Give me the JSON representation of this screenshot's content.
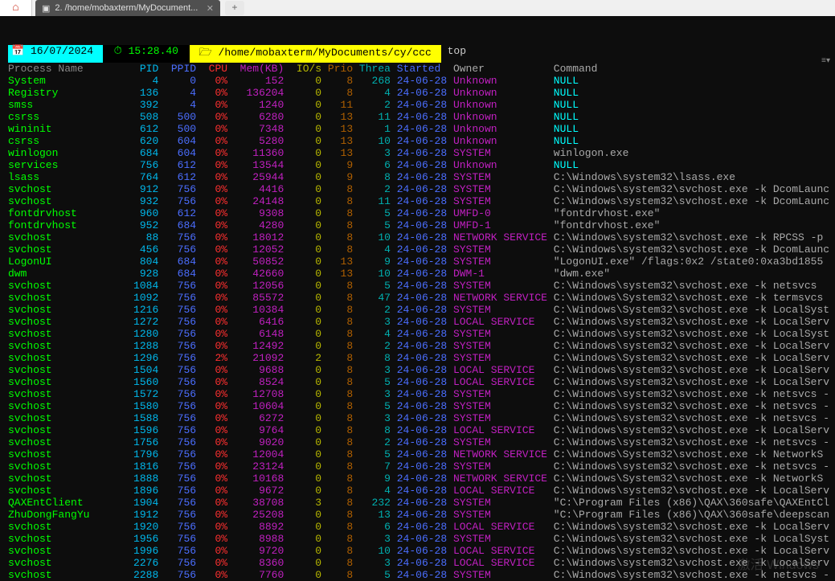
{
  "tab": {
    "title": "2. /home/mobaxterm/MyDocument..."
  },
  "status": {
    "date": "16/07/2024",
    "time": "15:28.40",
    "path": "/home/mobaxterm/MyDocuments/cy/ccc",
    "cmd": "top"
  },
  "headers": {
    "proc": "Process Name",
    "pid": "PID",
    "ppid": "PPID",
    "cpu": "CPU",
    "mem": "Mem(KB)",
    "io": "IO/s",
    "prio": "Prio",
    "threa": "Threa",
    "started": "Started",
    "owner": "Owner",
    "command": "Command"
  },
  "rows": [
    {
      "name": "System",
      "pid": "4",
      "ppid": "0",
      "cpu": "0%",
      "mem": "152",
      "io": "0",
      "prio": "8",
      "threa": "268",
      "started": "24-06-28",
      "owner": "Unknown",
      "cmd": "NULL"
    },
    {
      "name": "Registry",
      "pid": "136",
      "ppid": "4",
      "cpu": "0%",
      "mem": "136204",
      "io": "0",
      "prio": "8",
      "threa": "4",
      "started": "24-06-28",
      "owner": "Unknown",
      "cmd": "NULL"
    },
    {
      "name": "smss",
      "pid": "392",
      "ppid": "4",
      "cpu": "0%",
      "mem": "1240",
      "io": "0",
      "prio": "11",
      "threa": "2",
      "started": "24-06-28",
      "owner": "Unknown",
      "cmd": "NULL"
    },
    {
      "name": "csrss",
      "pid": "508",
      "ppid": "500",
      "cpu": "0%",
      "mem": "6280",
      "io": "0",
      "prio": "13",
      "threa": "11",
      "started": "24-06-28",
      "owner": "Unknown",
      "cmd": "NULL"
    },
    {
      "name": "wininit",
      "pid": "612",
      "ppid": "500",
      "cpu": "0%",
      "mem": "7348",
      "io": "0",
      "prio": "13",
      "threa": "1",
      "started": "24-06-28",
      "owner": "Unknown",
      "cmd": "NULL"
    },
    {
      "name": "csrss",
      "pid": "620",
      "ppid": "604",
      "cpu": "0%",
      "mem": "5280",
      "io": "0",
      "prio": "13",
      "threa": "10",
      "started": "24-06-28",
      "owner": "Unknown",
      "cmd": "NULL"
    },
    {
      "name": "winlogon",
      "pid": "684",
      "ppid": "604",
      "cpu": "0%",
      "mem": "11360",
      "io": "0",
      "prio": "13",
      "threa": "3",
      "started": "24-06-28",
      "owner": "SYSTEM",
      "cmd": "winlogon.exe"
    },
    {
      "name": "services",
      "pid": "756",
      "ppid": "612",
      "cpu": "0%",
      "mem": "13544",
      "io": "0",
      "prio": "9",
      "threa": "6",
      "started": "24-06-28",
      "owner": "Unknown",
      "cmd": "NULL"
    },
    {
      "name": "lsass",
      "pid": "764",
      "ppid": "612",
      "cpu": "0%",
      "mem": "25944",
      "io": "0",
      "prio": "9",
      "threa": "8",
      "started": "24-06-28",
      "owner": "SYSTEM",
      "cmd": "C:\\Windows\\system32\\lsass.exe"
    },
    {
      "name": "svchost",
      "pid": "912",
      "ppid": "756",
      "cpu": "0%",
      "mem": "4416",
      "io": "0",
      "prio": "8",
      "threa": "2",
      "started": "24-06-28",
      "owner": "SYSTEM",
      "cmd": "C:\\Windows\\system32\\svchost.exe -k DcomLaunc"
    },
    {
      "name": "svchost",
      "pid": "932",
      "ppid": "756",
      "cpu": "0%",
      "mem": "24148",
      "io": "0",
      "prio": "8",
      "threa": "11",
      "started": "24-06-28",
      "owner": "SYSTEM",
      "cmd": "C:\\Windows\\system32\\svchost.exe -k DcomLaunc"
    },
    {
      "name": "fontdrvhost",
      "pid": "960",
      "ppid": "612",
      "cpu": "0%",
      "mem": "9308",
      "io": "0",
      "prio": "8",
      "threa": "5",
      "started": "24-06-28",
      "owner": "UMFD-0",
      "cmd": "\"fontdrvhost.exe\""
    },
    {
      "name": "fontdrvhost",
      "pid": "952",
      "ppid": "684",
      "cpu": "0%",
      "mem": "4280",
      "io": "0",
      "prio": "8",
      "threa": "5",
      "started": "24-06-28",
      "owner": "UMFD-1",
      "cmd": "\"fontdrvhost.exe\""
    },
    {
      "name": "svchost",
      "pid": "88",
      "ppid": "756",
      "cpu": "0%",
      "mem": "18012",
      "io": "0",
      "prio": "8",
      "threa": "10",
      "started": "24-06-28",
      "owner": "NETWORK SERVICE",
      "cmd": "C:\\Windows\\system32\\svchost.exe -k RPCSS -p"
    },
    {
      "name": "svchost",
      "pid": "456",
      "ppid": "756",
      "cpu": "0%",
      "mem": "12052",
      "io": "0",
      "prio": "8",
      "threa": "4",
      "started": "24-06-28",
      "owner": "SYSTEM",
      "cmd": "C:\\Windows\\system32\\svchost.exe -k DcomLaunc"
    },
    {
      "name": "LogonUI",
      "pid": "804",
      "ppid": "684",
      "cpu": "0%",
      "mem": "50852",
      "io": "0",
      "prio": "13",
      "threa": "9",
      "started": "24-06-28",
      "owner": "SYSTEM",
      "cmd": "\"LogonUI.exe\" /flags:0x2 /state0:0xa3bd1855"
    },
    {
      "name": "dwm",
      "pid": "928",
      "ppid": "684",
      "cpu": "0%",
      "mem": "42660",
      "io": "0",
      "prio": "13",
      "threa": "10",
      "started": "24-06-28",
      "owner": "DWM-1",
      "cmd": "\"dwm.exe\""
    },
    {
      "name": "svchost",
      "pid": "1084",
      "ppid": "756",
      "cpu": "0%",
      "mem": "12056",
      "io": "0",
      "prio": "8",
      "threa": "5",
      "started": "24-06-28",
      "owner": "SYSTEM",
      "cmd": "C:\\Windows\\system32\\svchost.exe -k netsvcs"
    },
    {
      "name": "svchost",
      "pid": "1092",
      "ppid": "756",
      "cpu": "0%",
      "mem": "85572",
      "io": "0",
      "prio": "8",
      "threa": "47",
      "started": "24-06-28",
      "owner": "NETWORK SERVICE",
      "cmd": "C:\\Windows\\System32\\svchost.exe -k termsvcs"
    },
    {
      "name": "svchost",
      "pid": "1216",
      "ppid": "756",
      "cpu": "0%",
      "mem": "10384",
      "io": "0",
      "prio": "8",
      "threa": "2",
      "started": "24-06-28",
      "owner": "SYSTEM",
      "cmd": "C:\\Windows\\System32\\svchost.exe -k LocalSyst"
    },
    {
      "name": "svchost",
      "pid": "1272",
      "ppid": "756",
      "cpu": "0%",
      "mem": "6416",
      "io": "0",
      "prio": "8",
      "threa": "3",
      "started": "24-06-28",
      "owner": "LOCAL SERVICE",
      "cmd": "C:\\Windows\\system32\\svchost.exe -k LocalServ"
    },
    {
      "name": "svchost",
      "pid": "1280",
      "ppid": "756",
      "cpu": "0%",
      "mem": "6148",
      "io": "0",
      "prio": "8",
      "threa": "4",
      "started": "24-06-28",
      "owner": "SYSTEM",
      "cmd": "C:\\Windows\\system32\\svchost.exe -k LocalSyst"
    },
    {
      "name": "svchost",
      "pid": "1288",
      "ppid": "756",
      "cpu": "0%",
      "mem": "12492",
      "io": "0",
      "prio": "8",
      "threa": "2",
      "started": "24-06-28",
      "owner": "SYSTEM",
      "cmd": "C:\\Windows\\system32\\svchost.exe -k LocalServ"
    },
    {
      "name": "svchost",
      "pid": "1296",
      "ppid": "756",
      "cpu": "2%",
      "mem": "21092",
      "io": "2",
      "prio": "8",
      "threa": "8",
      "started": "24-06-28",
      "owner": "SYSTEM",
      "cmd": "C:\\Windows\\System32\\svchost.exe -k LocalServ"
    },
    {
      "name": "svchost",
      "pid": "1504",
      "ppid": "756",
      "cpu": "0%",
      "mem": "9688",
      "io": "0",
      "prio": "8",
      "threa": "3",
      "started": "24-06-28",
      "owner": "LOCAL SERVICE",
      "cmd": "C:\\Windows\\system32\\svchost.exe -k LocalServ"
    },
    {
      "name": "svchost",
      "pid": "1560",
      "ppid": "756",
      "cpu": "0%",
      "mem": "8524",
      "io": "0",
      "prio": "8",
      "threa": "5",
      "started": "24-06-28",
      "owner": "LOCAL SERVICE",
      "cmd": "C:\\Windows\\system32\\svchost.exe -k LocalServ"
    },
    {
      "name": "svchost",
      "pid": "1572",
      "ppid": "756",
      "cpu": "0%",
      "mem": "12708",
      "io": "0",
      "prio": "8",
      "threa": "3",
      "started": "24-06-28",
      "owner": "SYSTEM",
      "cmd": "C:\\Windows\\system32\\svchost.exe -k netsvcs -"
    },
    {
      "name": "svchost",
      "pid": "1580",
      "ppid": "756",
      "cpu": "0%",
      "mem": "10604",
      "io": "0",
      "prio": "8",
      "threa": "5",
      "started": "24-06-28",
      "owner": "SYSTEM",
      "cmd": "C:\\Windows\\system32\\svchost.exe -k netsvcs -"
    },
    {
      "name": "svchost",
      "pid": "1588",
      "ppid": "756",
      "cpu": "0%",
      "mem": "6272",
      "io": "0",
      "prio": "8",
      "threa": "3",
      "started": "24-06-28",
      "owner": "SYSTEM",
      "cmd": "C:\\Windows\\system32\\svchost.exe -k netsvcs -"
    },
    {
      "name": "svchost",
      "pid": "1596",
      "ppid": "756",
      "cpu": "0%",
      "mem": "9764",
      "io": "0",
      "prio": "8",
      "threa": "8",
      "started": "24-06-28",
      "owner": "LOCAL SERVICE",
      "cmd": "C:\\Windows\\system32\\svchost.exe -k LocalServ"
    },
    {
      "name": "svchost",
      "pid": "1756",
      "ppid": "756",
      "cpu": "0%",
      "mem": "9020",
      "io": "0",
      "prio": "8",
      "threa": "2",
      "started": "24-06-28",
      "owner": "SYSTEM",
      "cmd": "C:\\Windows\\system32\\svchost.exe -k netsvcs -"
    },
    {
      "name": "svchost",
      "pid": "1796",
      "ppid": "756",
      "cpu": "0%",
      "mem": "12004",
      "io": "0",
      "prio": "8",
      "threa": "5",
      "started": "24-06-28",
      "owner": "NETWORK SERVICE",
      "cmd": "C:\\Windows\\System32\\svchost.exe -k NetworkS"
    },
    {
      "name": "svchost",
      "pid": "1816",
      "ppid": "756",
      "cpu": "0%",
      "mem": "23124",
      "io": "0",
      "prio": "8",
      "threa": "7",
      "started": "24-06-28",
      "owner": "SYSTEM",
      "cmd": "C:\\Windows\\system32\\svchost.exe -k netsvcs -"
    },
    {
      "name": "svchost",
      "pid": "1888",
      "ppid": "756",
      "cpu": "0%",
      "mem": "10168",
      "io": "0",
      "prio": "8",
      "threa": "9",
      "started": "24-06-28",
      "owner": "NETWORK SERVICE",
      "cmd": "C:\\Windows\\System32\\svchost.exe -k NetworkS"
    },
    {
      "name": "svchost",
      "pid": "1896",
      "ppid": "756",
      "cpu": "0%",
      "mem": "9672",
      "io": "0",
      "prio": "8",
      "threa": "4",
      "started": "24-06-28",
      "owner": "LOCAL SERVICE",
      "cmd": "C:\\Windows\\system32\\svchost.exe -k LocalServ"
    },
    {
      "name": "QAXEntClient",
      "pid": "1904",
      "ppid": "756",
      "cpu": "0%",
      "mem": "38708",
      "io": "3",
      "prio": "8",
      "threa": "232",
      "started": "24-06-28",
      "owner": "SYSTEM",
      "cmd": "\"C:\\Program Files (x86)\\QAX\\360safe\\QAXEntCl"
    },
    {
      "name": "ZhuDongFangYu",
      "pid": "1912",
      "ppid": "756",
      "cpu": "0%",
      "mem": "25208",
      "io": "0",
      "prio": "8",
      "threa": "13",
      "started": "24-06-28",
      "owner": "SYSTEM",
      "cmd": "\"C:\\Program Files (x86)\\QAX\\360safe\\deepscan"
    },
    {
      "name": "svchost",
      "pid": "1920",
      "ppid": "756",
      "cpu": "0%",
      "mem": "8892",
      "io": "0",
      "prio": "8",
      "threa": "6",
      "started": "24-06-28",
      "owner": "LOCAL SERVICE",
      "cmd": "C:\\Windows\\system32\\svchost.exe -k LocalServ"
    },
    {
      "name": "svchost",
      "pid": "1956",
      "ppid": "756",
      "cpu": "0%",
      "mem": "8988",
      "io": "0",
      "prio": "8",
      "threa": "3",
      "started": "24-06-28",
      "owner": "SYSTEM",
      "cmd": "C:\\Windows\\system32\\svchost.exe -k LocalSyst"
    },
    {
      "name": "svchost",
      "pid": "1996",
      "ppid": "756",
      "cpu": "0%",
      "mem": "9720",
      "io": "0",
      "prio": "8",
      "threa": "10",
      "started": "24-06-28",
      "owner": "LOCAL SERVICE",
      "cmd": "C:\\Windows\\system32\\svchost.exe -k LocalServ"
    },
    {
      "name": "svchost",
      "pid": "2276",
      "ppid": "756",
      "cpu": "0%",
      "mem": "8360",
      "io": "0",
      "prio": "8",
      "threa": "3",
      "started": "24-06-28",
      "owner": "LOCAL SERVICE",
      "cmd": "C:\\Windows\\system32\\svchost.exe -k LocalServ"
    },
    {
      "name": "svchost",
      "pid": "2288",
      "ppid": "756",
      "cpu": "0%",
      "mem": "7760",
      "io": "0",
      "prio": "8",
      "threa": "5",
      "started": "24-06-28",
      "owner": "SYSTEM",
      "cmd": "C:\\Windows\\system32\\svchost.exe -k netsvcs -"
    }
  ],
  "watermark": "激活 Windows"
}
